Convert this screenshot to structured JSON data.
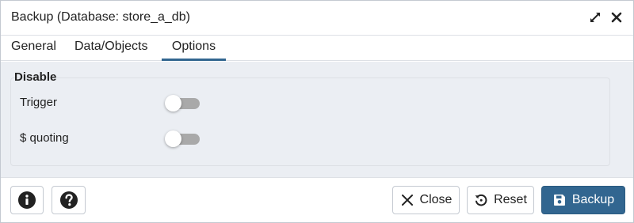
{
  "dialog": {
    "title": "Backup (Database: store_a_db)",
    "icons": {
      "expand": "expand-icon",
      "close": "close-icon"
    }
  },
  "tabs": [
    {
      "label": "General",
      "active": false
    },
    {
      "label": "Data/Objects",
      "active": false
    },
    {
      "label": "Options",
      "active": true
    }
  ],
  "options": {
    "section_title": "Disable",
    "rows": [
      {
        "label": "Trigger",
        "enabled": false
      },
      {
        "label": "$ quoting",
        "enabled": false
      }
    ]
  },
  "footer": {
    "info_icon": "info-icon",
    "help_icon": "help-icon",
    "close_label": "Close",
    "reset_label": "Reset",
    "backup_label": "Backup"
  },
  "colors": {
    "accent": "#326690",
    "content_bg": "#ebeef3",
    "switch_off": "#a9a9a9"
  }
}
